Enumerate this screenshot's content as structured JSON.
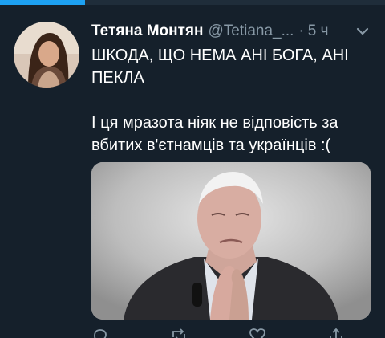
{
  "tweet": {
    "display_name": "Тетяна Монтян",
    "handle": "@Tetiana_...",
    "separator": "·",
    "time": "5 ч",
    "text_line1": "ШКОДА, ЩО НЕМА АНІ БОГА, АНІ ПЕКЛА",
    "text_line2": "І ця мразота ніяк не відповість за вбитих в'єтнамців та українців :("
  },
  "icons": {
    "menu": "chevron-down-icon",
    "reply": "reply-icon",
    "retweet": "retweet-icon",
    "like": "heart-icon",
    "share": "share-icon"
  },
  "colors": {
    "background": "#15202b",
    "text": "#ffffff",
    "secondary": "#8899a6",
    "accent": "#1da1f2"
  }
}
